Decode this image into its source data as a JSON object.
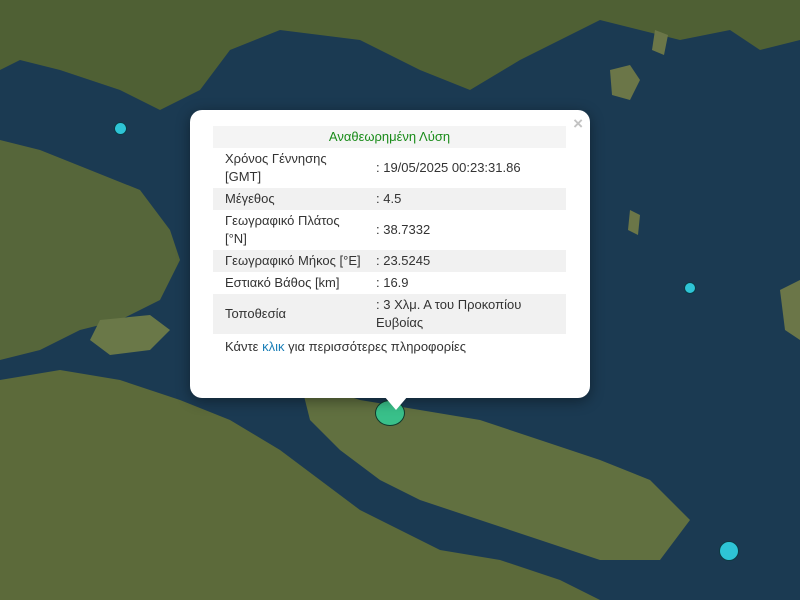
{
  "popup": {
    "title": "Αναθεωρημένη Λύση",
    "close_symbol": "×",
    "rows": [
      {
        "key": "Χρόνος Γέννησης [GMT]",
        "value": ": 19/05/2025 00:23:31.86"
      },
      {
        "key": "Μέγεθος",
        "value": ": 4.5"
      },
      {
        "key": "Γεωγραφικό Πλάτος [°N]",
        "value": ": 38.7332"
      },
      {
        "key": "Γεωγραφικό Μήκος [°E]",
        "value": ": 23.5245"
      },
      {
        "key": "Εστιακό Βάθος [km]",
        "value": ": 16.9"
      },
      {
        "key": "Τοποθεσία",
        "value": ": 3 Χλμ. Α του Προκοπίου Ευβοίας"
      }
    ],
    "more_prefix": "Κάντε ",
    "more_link": "κλικ",
    "more_suffix": " για περισσότερες πληροφορίες"
  },
  "colors": {
    "sea": "#1b3a52",
    "land": "#5a6a3c",
    "marker": "#2ec4d6",
    "title_green": "#1a8c1a",
    "link_blue": "#1b7fb8"
  },
  "markers": [
    "earthquake-marker-main",
    "earthquake-marker-1",
    "earthquake-marker-2",
    "earthquake-marker-3"
  ]
}
